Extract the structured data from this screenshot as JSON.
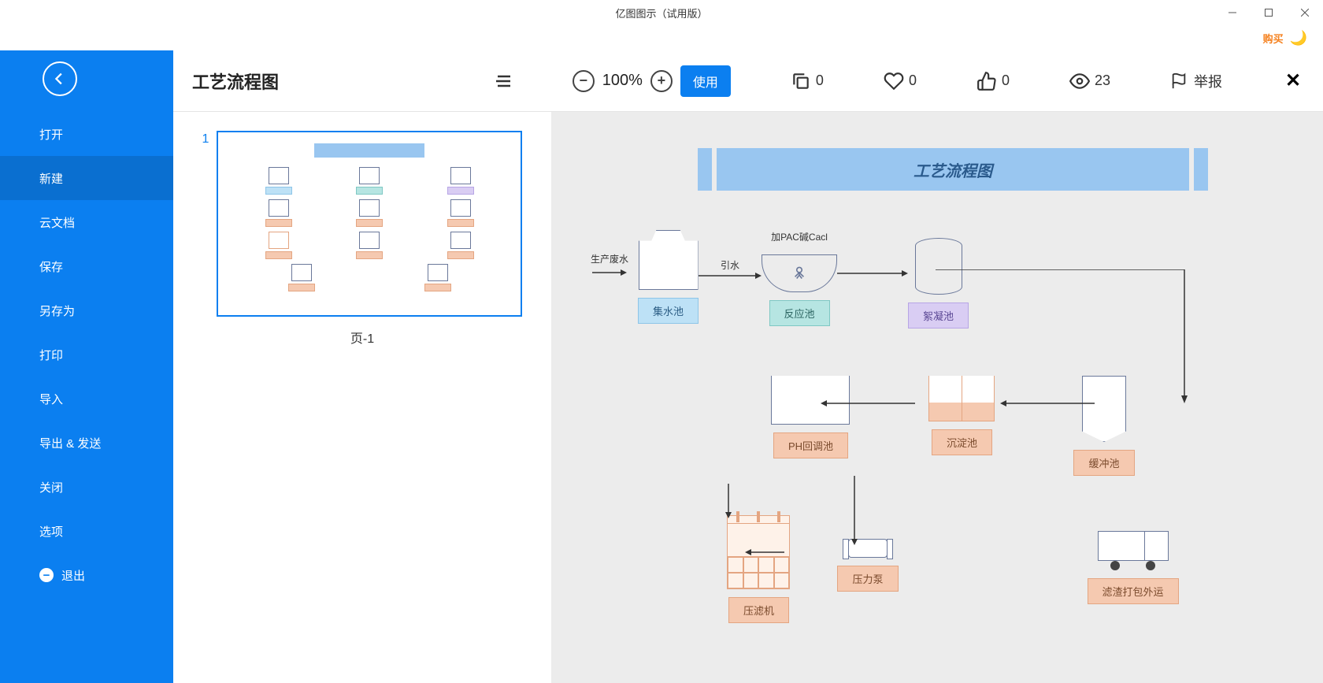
{
  "app": {
    "title": "亿图图示（试用版）"
  },
  "upper": {
    "buy": "购买"
  },
  "sidebar": {
    "items": [
      {
        "label": "打开"
      },
      {
        "label": "新建"
      },
      {
        "label": "云文档"
      },
      {
        "label": "保存"
      },
      {
        "label": "另存为"
      },
      {
        "label": "打印"
      },
      {
        "label": "导入"
      },
      {
        "label": "导出 & 发送"
      },
      {
        "label": "关闭"
      },
      {
        "label": "选项"
      },
      {
        "label": "退出"
      }
    ],
    "active_index": 1
  },
  "toolbar": {
    "doc_title": "工艺流程图",
    "zoom": "100%",
    "use_label": "使用",
    "copy_count": "0",
    "like_count": "0",
    "thumb_count": "0",
    "view_count": "23",
    "report_label": "举报"
  },
  "thumb": {
    "page_num": "1",
    "page_label": "页-1"
  },
  "diagram": {
    "title": "工艺流程图",
    "inflow": "生产废水",
    "note_pac": "加PAC碱Cacl",
    "note_water": "引水",
    "labels": {
      "tank1": "集水池",
      "react": "反应池",
      "floc": "絮凝池",
      "ph": "PH回调池",
      "sed": "沉淀池",
      "buf": "缓冲池",
      "press": "压滤机",
      "pump": "压力泵",
      "truck": "滤渣打包外运"
    }
  }
}
